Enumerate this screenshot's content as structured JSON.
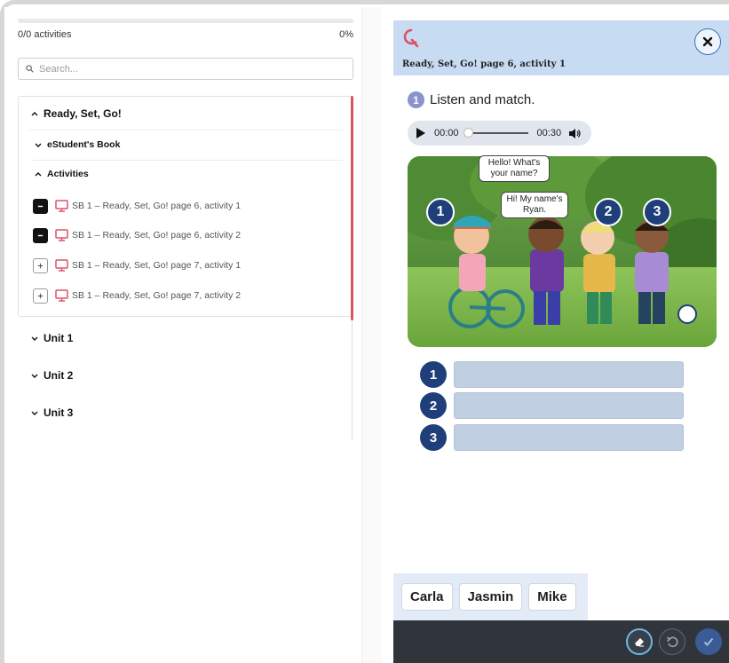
{
  "left": {
    "progress": {
      "label": "0/0 activities",
      "percent_label": "0%",
      "fraction": 0
    },
    "search": {
      "placeholder": "Search..."
    },
    "tree": {
      "section": "Ready, Set, Go!",
      "book": "eStudent's Book",
      "group": "Activities",
      "activities": [
        {
          "label": "SB 1 – Ready, Set, Go! page 6, activity 1",
          "state": "minus"
        },
        {
          "label": "SB 1 – Ready, Set, Go! page 6, activity 2",
          "state": "minus"
        },
        {
          "label": "SB 1 – Ready, Set, Go! page 7, activity 1",
          "state": "plus"
        },
        {
          "label": "SB 1 – Ready, Set, Go! page 7, activity 2",
          "state": "plus"
        }
      ],
      "units": [
        "Unit 1",
        "Unit 2",
        "Unit 3"
      ]
    }
  },
  "right": {
    "header_title": "Ready, Set, Go! page 6, activity 1",
    "question_number": "1",
    "instruction": "Listen and match.",
    "audio": {
      "current": "00:00",
      "duration": "00:30"
    },
    "bubbles": [
      "Hello! What's your name?",
      "Hi! My name's Ryan."
    ],
    "scene_badges": [
      "1",
      "2",
      "3"
    ],
    "answers": [
      "1",
      "2",
      "3"
    ],
    "word_bank": [
      "Carla",
      "Jasmin",
      "Mike"
    ]
  },
  "colors": {
    "accent": "#d9536b",
    "header_bg": "#c7dbf3",
    "badge": "#1f3f7a",
    "footer": "#2f353b"
  }
}
